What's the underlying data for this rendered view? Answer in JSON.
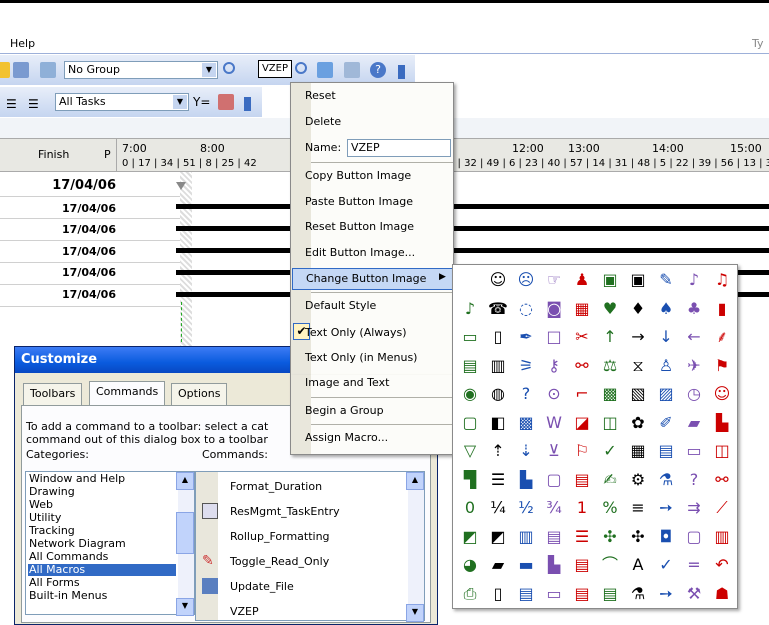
{
  "menubar": {
    "help": "Help",
    "type_hint": "Ty"
  },
  "toolbar1": {
    "group_combo": "No Group",
    "vzep_button": "VZEP"
  },
  "toolbar2": {
    "filter_combo": "All Tasks"
  },
  "table": {
    "col_finish": "Finish",
    "col_p": "P",
    "rows": [
      "17/04/06",
      "17/04/06",
      "17/04/06",
      "17/04/06",
      "17/04/06",
      "17/04/06"
    ]
  },
  "timescale": {
    "hours": [
      "7:00",
      "8:00",
      "12:00",
      "13:00",
      "14:00",
      "15:00"
    ],
    "minutes_left": "0 | 17 | 34 | 51 | 8 | 25 | 42",
    "minutes_right": "5 | 32 | 49 | 6 | 23 | 40 | 57 | 14 | 31 | 48 | 5 | 22 | 39 | 56 | 13 | 3"
  },
  "context_menu": {
    "reset": "Reset",
    "delete": "Delete",
    "name_label": "Name:",
    "name_value": "VZEP",
    "copy_image": "Copy Button Image",
    "paste_image": "Paste Button Image",
    "reset_image": "Reset Button Image",
    "edit_image": "Edit Button Image...",
    "change_image": "Change Button Image",
    "default_style": "Default Style",
    "text_only_always": "Text Only (Always)",
    "text_only_menus": "Text Only (in Menus)",
    "image_and_text": "Image and Text",
    "begin_group": "Begin a Group",
    "assign_macro": "Assign Macro..."
  },
  "dialog": {
    "title": "Customize",
    "tabs": [
      "Toolbars",
      "Commands",
      "Options"
    ],
    "instruction_line1": "To add a command to a toolbar: select a cat",
    "instruction_line2": "command out of this dialog box to a toolbar",
    "categories_label": "Categories:",
    "commands_label": "Commands:",
    "categories": [
      "Window and Help",
      "Drawing",
      "Web",
      "Utility",
      "Tracking",
      "Network Diagram",
      "All Commands",
      "All Macros",
      "All Forms",
      "Built-in Menus"
    ],
    "commands": [
      "Format_Duration",
      "ResMgmt_TaskEntry",
      "Rollup_Formatting",
      "Toggle_Read_Only",
      "Update_File",
      "VZEP"
    ]
  },
  "palette_icons": [
    "smiley-icon",
    "frown-icon",
    "pointing-hand-icon",
    "push-pin-icon",
    "disk-icon",
    "disk-icon",
    "pencil-icon",
    "speaker-icon",
    "bell-icon",
    "music-note-icon",
    "telephone-icon",
    "speech-bubble-icon",
    "drum-icon",
    "calendar-icon",
    "heart-icon",
    "diamond-icon",
    "spade-icon",
    "club-icon",
    "trash-can-icon",
    "projector-icon",
    "wastebasket-icon",
    "pen-icon",
    "blank-icon",
    "scissors-icon",
    "arrow-up-icon",
    "arrow-right-icon",
    "arrow-down-icon",
    "arrow-left-icon",
    "broom-icon",
    "box-icon",
    "book-icon",
    "radio-icon",
    "key-icon",
    "chain-icon",
    "scales-icon",
    "hourglass-icon",
    "person-icon",
    "bird-icon",
    "runner-icon",
    "eye-icon",
    "globe-icon",
    "question-icon",
    "search-icon",
    "bracket-icon",
    "calculator-icon",
    "keyboard-icon",
    "film-icon",
    "clock-icon",
    "smiley-icon",
    "form-icon",
    "access-icon",
    "excel-icon",
    "word-icon",
    "powerpoint-icon",
    "binder-icon",
    "graphics-icon",
    "paint-icon",
    "folder-icon",
    "chart-icon",
    "funnel-icon",
    "sort-asc-icon",
    "sort-desc-icon",
    "filter-icon",
    "flag-icon",
    "check-icon",
    "grid-icon",
    "table-icon",
    "window-icon",
    "split-icon",
    "report-icon",
    "list-icon",
    "chart-icon",
    "monitor-icon",
    "table-icon",
    "note-icon",
    "gear-icon",
    "paint-bucket-icon",
    "help-icon",
    "chain-icon",
    "percent-0-icon",
    "percent-25-icon",
    "percent-50-icon",
    "percent-75-icon",
    "percent-100-icon",
    "percent-icon",
    "equal-icon",
    "arrow-icon",
    "arrows-icon",
    "diagonal-icon",
    "image-icon",
    "image-icon",
    "bars-icon",
    "table-icon",
    "list-icon",
    "puzzle-icon",
    "puzzle-icon",
    "cylinder-icon",
    "monitor-icon",
    "bars-icon",
    "pie-icon",
    "folder-icon",
    "tray-icon",
    "chart-icon",
    "table-icon",
    "paperclip-icon",
    "abc-icon",
    "check-icon",
    "equals-icon",
    "undo-icon",
    "printer-icon",
    "door-icon",
    "page-icon",
    "window-icon",
    "box-icon",
    "table-icon",
    "flask-icon",
    "arrow-icon",
    "tools-icon",
    "people-icon"
  ]
}
